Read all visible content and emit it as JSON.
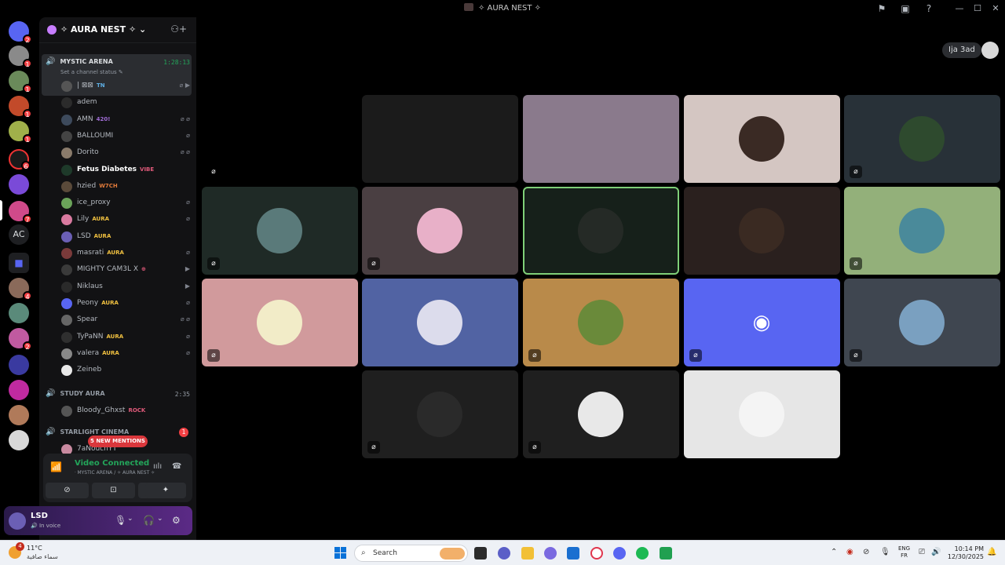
{
  "window": {
    "title": "✧ AURA NEST ✧"
  },
  "rail": {
    "badges": [
      "2",
      "1",
      "1",
      "1",
      "1",
      "6",
      "7",
      "4",
      "2"
    ],
    "text_server": "AC"
  },
  "sidebar": {
    "guild_name": "✧ AURA NEST ✧",
    "active_channel": {
      "name": "MYSTIC ARENA",
      "time": "1:28:13",
      "status": "Set a channel status"
    },
    "members": [
      {
        "name": "| ⊠⊠",
        "tag": "TN",
        "tag_color": "#5dade2",
        "icons": "⌀ ▶",
        "bold": false,
        "avatar": "#555"
      },
      {
        "name": "adem",
        "tag": "",
        "tag_color": "",
        "icons": "",
        "bold": false,
        "avatar": "#2b2b2b"
      },
      {
        "name": "AMN",
        "tag": "420!",
        "tag_color": "#a06cd5",
        "icons": "⌀ ⌀",
        "bold": false,
        "avatar": "#3d4a5c"
      },
      {
        "name": "BALLOUMI",
        "tag": "",
        "tag_color": "",
        "icons": "⌀",
        "bold": false,
        "avatar": "#444"
      },
      {
        "name": "Dorito",
        "tag": "",
        "tag_color": "",
        "icons": "⌀ ⌀",
        "bold": false,
        "avatar": "#8a7b6b"
      },
      {
        "name": "Fetus Diabetes",
        "tag": "VIBE",
        "tag_color": "#e05a7a",
        "icons": "",
        "bold": true,
        "avatar": "#1e3a2a"
      },
      {
        "name": "hzied",
        "tag": "W7CH",
        "tag_color": "#e07a3a",
        "icons": "",
        "bold": false,
        "avatar": "#5a4a3a"
      },
      {
        "name": "ice_proxy",
        "tag": "",
        "tag_color": "",
        "icons": "⌀",
        "bold": false,
        "avatar": "#6ba35a"
      },
      {
        "name": "Lily",
        "tag": "AURA",
        "tag_color": "#f0c040",
        "icons": "⌀",
        "bold": false,
        "avatar": "#d97aa0"
      },
      {
        "name": "LSD",
        "tag": "AURA",
        "tag_color": "#f0c040",
        "icons": "",
        "bold": false,
        "avatar": "#6b5fb5"
      },
      {
        "name": "masrati",
        "tag": "AURA",
        "tag_color": "#f0c040",
        "icons": "⌀",
        "bold": false,
        "avatar": "#7a3a3a"
      },
      {
        "name": "MIGHTY CAM3L X",
        "tag": "⊕",
        "tag_color": "#e05a7a",
        "icons": "▶",
        "bold": false,
        "avatar": "#3a3a3a"
      },
      {
        "name": "Niklaus",
        "tag": "",
        "tag_color": "",
        "icons": "▶",
        "bold": false,
        "avatar": "#2a2a2a"
      },
      {
        "name": "Peony",
        "tag": "AURA",
        "tag_color": "#f0c040",
        "icons": "⌀",
        "bold": false,
        "avatar": "#5865f2"
      },
      {
        "name": "Spear",
        "tag": "",
        "tag_color": "",
        "icons": "⌀ ⌀",
        "bold": false,
        "avatar": "#666"
      },
      {
        "name": "TyPaNN",
        "tag": "AURA",
        "tag_color": "#f0c040",
        "icons": "⌀",
        "bold": false,
        "avatar": "#2f2f2f"
      },
      {
        "name": "valera",
        "tag": "AURA",
        "tag_color": "#f0c040",
        "icons": "⌀",
        "bold": false,
        "avatar": "#888"
      },
      {
        "name": "Zeineb",
        "tag": "",
        "tag_color": "",
        "icons": "",
        "bold": false,
        "avatar": "#e8e8e8"
      }
    ],
    "study_channel": {
      "name": "STUDY AURA",
      "time": "2:35"
    },
    "study_member": {
      "name": "Bloody_Ghxst",
      "tag": "ROCK",
      "tag_color": "#e05a7a"
    },
    "cinema_channel": {
      "name": "STARLIGHT CINEMA",
      "badge": "1"
    },
    "cinema_member": {
      "name": "7aNouchYT"
    },
    "mentions": "5 NEW MENTIONS"
  },
  "voice": {
    "status": "Video Connected",
    "location": "ᐧ MYSTIC ARENA / ✧ AURA NEST ✧"
  },
  "user": {
    "name": "LSD",
    "status": "In voice"
  },
  "main": {
    "name_pill": "Ija 3ad",
    "tiles": [
      {
        "bg": "#000000",
        "avatar": "",
        "muted": true
      },
      {
        "bg": "#1b1b1b",
        "avatar": "",
        "muted": false
      },
      {
        "bg": "#8a7a8c",
        "avatar": "",
        "muted": false
      },
      {
        "bg": "#d4c6c2",
        "avatar": "#3a2a24",
        "muted": false
      },
      {
        "bg": "#283138",
        "avatar": "#2e4a2e",
        "muted": true
      },
      {
        "bg": "#1f2a26",
        "avatar": "#5a7a7a",
        "muted": true
      },
      {
        "bg": "#4a3f42",
        "avatar": "#e8b0c8",
        "muted": true
      },
      {
        "bg": "#16201a",
        "avatar": "#252a26",
        "muted": false
      },
      {
        "bg": "#2a201e",
        "avatar": "#3a2a22",
        "muted": false
      },
      {
        "bg": "#93b07a",
        "avatar": "#4a8a9a",
        "muted": true
      },
      {
        "bg": "#d19a9c",
        "avatar": "#f2ecc8",
        "muted": true
      },
      {
        "bg": "#5163a3",
        "avatar": "#dcdcec",
        "muted": false
      },
      {
        "bg": "#b98a4a",
        "avatar": "#6a8a3a",
        "muted": true
      },
      {
        "bg": "#5865f2",
        "avatar": "discord",
        "muted": true
      },
      {
        "bg": "#3f4650",
        "avatar": "#7aa0c0",
        "muted": true
      },
      {
        "bg": "#1f1f1f",
        "avatar": "#2a2a2a",
        "muted": true
      },
      {
        "bg": "#1f1f1f",
        "avatar": "#e8e8e8",
        "muted": true
      },
      {
        "bg": "#e6e6e6",
        "avatar": "#f4f4f4",
        "muted": false
      }
    ]
  },
  "taskbar": {
    "temperature": "11°C",
    "condition": "سماء صافية",
    "weather_badge": "4",
    "search_placeholder": "Search",
    "lang_line1": "ENG",
    "lang_line2": "FR",
    "time": "10:14 PM",
    "date": "12/30/2025"
  },
  "colors": {
    "accent": "#5865f2",
    "connected": "#23a55a",
    "speaking": "#7fcf78",
    "mention": "#da373c"
  }
}
